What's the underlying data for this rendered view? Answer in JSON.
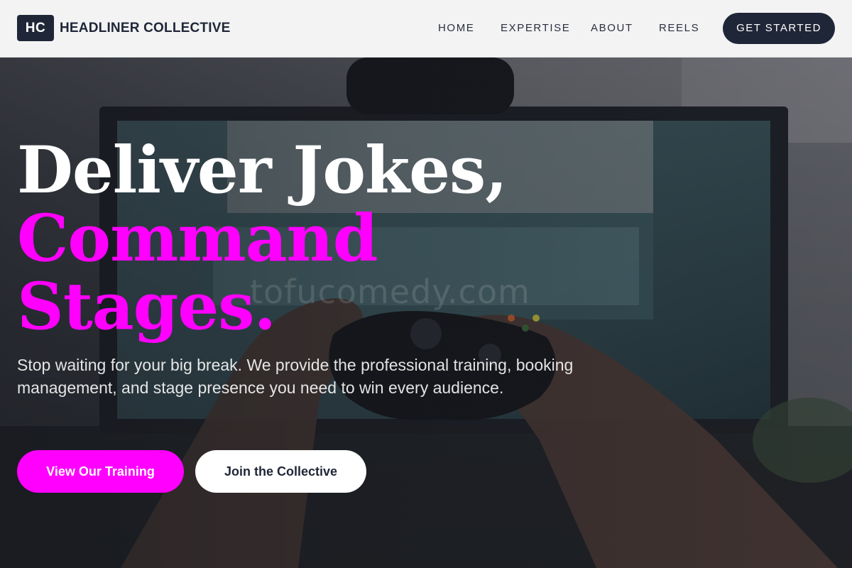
{
  "brand": {
    "badge": "HC",
    "name": "HEADLINER COLLECTIVE"
  },
  "nav": {
    "items": [
      "HOME",
      "EXPERTISE",
      "ABOUT",
      "REELS"
    ],
    "cta": "GET STARTED"
  },
  "hero": {
    "headline_line1": "Deliver Jokes,",
    "headline_line2": "Command",
    "headline_line3": "Stages.",
    "subtext": "Stop waiting for your big break. We provide the professional training, booking management, and stage presence you need to win every audience.",
    "primary_button": "View Our Training",
    "secondary_button": "Join the Collective"
  },
  "watermark": "tofucomedy.com",
  "colors": {
    "accent": "#ff00ff",
    "dark": "#1f2637",
    "header_bg": "#f3f3f4"
  }
}
